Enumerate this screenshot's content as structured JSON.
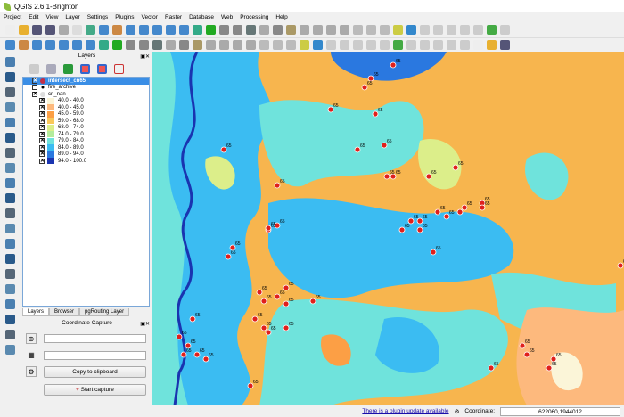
{
  "window": {
    "title": "QGIS 2.6.1-Brighton"
  },
  "menu": [
    "Project",
    "Edit",
    "View",
    "Layer",
    "Settings",
    "Plugins",
    "Vector",
    "Raster",
    "Database",
    "Web",
    "Processing",
    "Help"
  ],
  "layers_panel": {
    "title": "Layers",
    "layers": [
      {
        "name": "intersect_cn65",
        "checked": true,
        "selected": true
      },
      {
        "name": "fire_archive",
        "checked": false
      },
      {
        "name": "cn_nan",
        "checked": true
      }
    ],
    "legend": [
      {
        "label": "40.0 - 40.0",
        "color": "#fbf5d8"
      },
      {
        "label": "40.0 - 45.0",
        "color": "#fdb97d"
      },
      {
        "label": "45.0 - 59.0",
        "color": "#fc9f45"
      },
      {
        "label": "59.0 - 68.0",
        "color": "#f9c85a"
      },
      {
        "label": "68.0 - 74.0",
        "color": "#dcee8a"
      },
      {
        "label": "74.0 - 79.0",
        "color": "#b4ec9c"
      },
      {
        "label": "79.0 - 84.0",
        "color": "#6fe3dc"
      },
      {
        "label": "84.0 - 89.0",
        "color": "#3bbcf2"
      },
      {
        "label": "89.0 - 94.0",
        "color": "#2a78e0"
      },
      {
        "label": "94.0 - 100.0",
        "color": "#1a34b0"
      }
    ]
  },
  "tabs": [
    "Layers",
    "Browser",
    "pgRouting Layer"
  ],
  "coordinate_capture": {
    "title": "Coordinate Capture",
    "field1": "",
    "field2": "",
    "copy_label": "Copy to clipboard",
    "start_label": "Start capture"
  },
  "map": {
    "point_label": "65",
    "point_color": "#e0201c"
  },
  "status": {
    "plugin_update": "There is a plugin update available",
    "coordinate_label": "Coordinate:",
    "coordinate_value": "622060,1944012"
  }
}
